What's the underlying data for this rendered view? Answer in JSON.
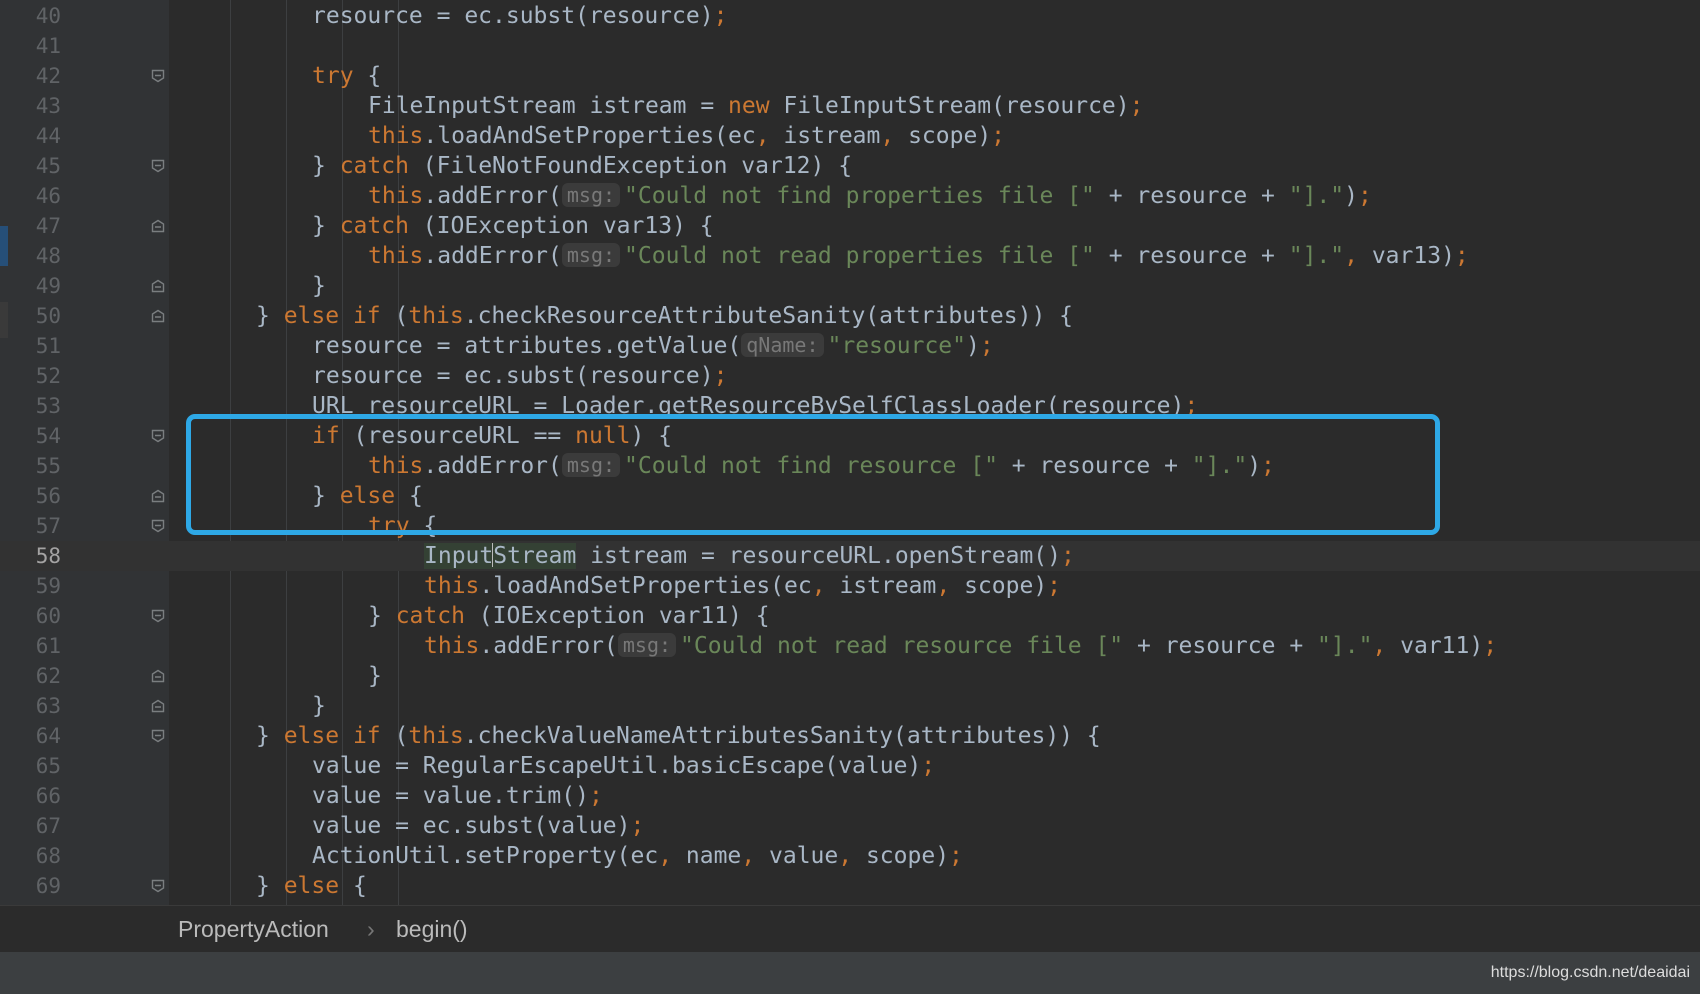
{
  "editor": {
    "lines": [
      {
        "n": "40",
        "indent": 5,
        "fold": "",
        "tokens": [
          [
            "t",
            "resource = ec.subst(resource)"
          ],
          [
            "k",
            ";"
          ]
        ]
      },
      {
        "n": "41",
        "indent": 0,
        "fold": "",
        "tokens": []
      },
      {
        "n": "42",
        "indent": 5,
        "fold": "open",
        "tokens": [
          [
            "k",
            "try"
          ],
          [
            "t",
            " {"
          ]
        ]
      },
      {
        "n": "43",
        "indent": 6,
        "fold": "",
        "tokens": [
          [
            "t",
            "FileInputStream istream = "
          ],
          [
            "k",
            "new"
          ],
          [
            "t",
            " FileInputStream(resource)"
          ],
          [
            "k",
            ";"
          ]
        ]
      },
      {
        "n": "44",
        "indent": 6,
        "fold": "",
        "tokens": [
          [
            "k",
            "this"
          ],
          [
            "t",
            ".loadAndSetProperties(ec"
          ],
          [
            "k",
            ","
          ],
          [
            "t",
            " istream"
          ],
          [
            "k",
            ","
          ],
          [
            "t",
            " scope)"
          ],
          [
            "k",
            ";"
          ]
        ]
      },
      {
        "n": "45",
        "indent": 5,
        "fold": "open",
        "tokens": [
          [
            "t",
            "} "
          ],
          [
            "k",
            "catch"
          ],
          [
            "t",
            " (FileNotFoundException var12) {"
          ]
        ]
      },
      {
        "n": "46",
        "indent": 6,
        "fold": "",
        "tokens": [
          [
            "k",
            "this"
          ],
          [
            "t",
            ".addError("
          ],
          [
            "h",
            "msg:"
          ],
          [
            "s",
            "\"Could not find properties file [\""
          ],
          [
            "t",
            " + resource + "
          ],
          [
            "s",
            "\"].\""
          ],
          [
            "t",
            ")"
          ],
          [
            "k",
            ";"
          ]
        ]
      },
      {
        "n": "47",
        "indent": 5,
        "fold": "close",
        "tokens": [
          [
            "t",
            "} "
          ],
          [
            "k",
            "catch"
          ],
          [
            "t",
            " (IOException var13) {"
          ]
        ]
      },
      {
        "n": "48",
        "indent": 6,
        "fold": "",
        "tokens": [
          [
            "k",
            "this"
          ],
          [
            "t",
            ".addError("
          ],
          [
            "h",
            "msg:"
          ],
          [
            "s",
            "\"Could not read properties file [\""
          ],
          [
            "t",
            " + resource + "
          ],
          [
            "s",
            "\"].\""
          ],
          [
            "k",
            ","
          ],
          [
            "t",
            " var13)"
          ],
          [
            "k",
            ";"
          ]
        ]
      },
      {
        "n": "49",
        "indent": 5,
        "fold": "close",
        "tokens": [
          [
            "t",
            "}"
          ]
        ]
      },
      {
        "n": "50",
        "indent": 4,
        "fold": "close",
        "tokens": [
          [
            "t",
            "} "
          ],
          [
            "k",
            "else if"
          ],
          [
            "t",
            " ("
          ],
          [
            "k",
            "this"
          ],
          [
            "t",
            ".checkResourceAttributeSanity(attributes)) {"
          ]
        ]
      },
      {
        "n": "51",
        "indent": 5,
        "fold": "",
        "tokens": [
          [
            "t",
            "resource = attributes.getValue("
          ],
          [
            "h",
            "qName:"
          ],
          [
            "s",
            "\"resource\""
          ],
          [
            "t",
            ")"
          ],
          [
            "k",
            ";"
          ]
        ]
      },
      {
        "n": "52",
        "indent": 5,
        "fold": "",
        "tokens": [
          [
            "t",
            "resource = ec.subst(resource)"
          ],
          [
            "k",
            ";"
          ]
        ]
      },
      {
        "n": "53",
        "indent": 5,
        "fold": "",
        "tokens": [
          [
            "t",
            "URL resourceURL = Loader.getResourceBySelfClassLoader(resource)"
          ],
          [
            "k",
            ";"
          ]
        ]
      },
      {
        "n": "54",
        "indent": 5,
        "fold": "open",
        "tokens": [
          [
            "k",
            "if"
          ],
          [
            "t",
            " (resourceURL == "
          ],
          [
            "k",
            "null"
          ],
          [
            "t",
            ") {"
          ]
        ]
      },
      {
        "n": "55",
        "indent": 6,
        "fold": "",
        "tokens": [
          [
            "k",
            "this"
          ],
          [
            "t",
            ".addError("
          ],
          [
            "h",
            "msg:"
          ],
          [
            "s",
            "\"Could not find resource [\""
          ],
          [
            "t",
            " + resource + "
          ],
          [
            "s",
            "\"].\""
          ],
          [
            "t",
            ")"
          ],
          [
            "k",
            ";"
          ]
        ]
      },
      {
        "n": "56",
        "indent": 5,
        "fold": "close",
        "tokens": [
          [
            "t",
            "} "
          ],
          [
            "k",
            "else"
          ],
          [
            "t",
            " {"
          ]
        ]
      },
      {
        "n": "57",
        "indent": 6,
        "fold": "open",
        "tokens": [
          [
            "k",
            "try"
          ],
          [
            "t",
            " {"
          ]
        ]
      },
      {
        "n": "58",
        "indent": 7,
        "fold": "",
        "current": true,
        "tokens": [
          [
            "m1",
            "Input"
          ],
          [
            "c",
            ""
          ],
          [
            "m2",
            "Stream"
          ],
          [
            "t",
            " istream = resourceURL.openStream()"
          ],
          [
            "k",
            ";"
          ]
        ]
      },
      {
        "n": "59",
        "indent": 7,
        "fold": "",
        "tokens": [
          [
            "k",
            "this"
          ],
          [
            "t",
            ".loadAndSetProperties(ec"
          ],
          [
            "k",
            ","
          ],
          [
            "t",
            " istream"
          ],
          [
            "k",
            ","
          ],
          [
            "t",
            " scope)"
          ],
          [
            "k",
            ";"
          ]
        ]
      },
      {
        "n": "60",
        "indent": 6,
        "fold": "open",
        "tokens": [
          [
            "t",
            "} "
          ],
          [
            "k",
            "catch"
          ],
          [
            "t",
            " (IOException var11) {"
          ]
        ]
      },
      {
        "n": "61",
        "indent": 7,
        "fold": "",
        "tokens": [
          [
            "k",
            "this"
          ],
          [
            "t",
            ".addError("
          ],
          [
            "h",
            "msg:"
          ],
          [
            "s",
            "\"Could not read resource file [\""
          ],
          [
            "t",
            " + resource + "
          ],
          [
            "s",
            "\"].\""
          ],
          [
            "k",
            ","
          ],
          [
            "t",
            " var11)"
          ],
          [
            "k",
            ";"
          ]
        ]
      },
      {
        "n": "62",
        "indent": 6,
        "fold": "close",
        "tokens": [
          [
            "t",
            "}"
          ]
        ]
      },
      {
        "n": "63",
        "indent": 5,
        "fold": "close",
        "tokens": [
          [
            "t",
            "}"
          ]
        ]
      },
      {
        "n": "64",
        "indent": 4,
        "fold": "open",
        "tokens": [
          [
            "t",
            "} "
          ],
          [
            "k",
            "else if"
          ],
          [
            "t",
            " ("
          ],
          [
            "k",
            "this"
          ],
          [
            "t",
            ".checkValueNameAttributesSanity(attributes)) {"
          ]
        ]
      },
      {
        "n": "65",
        "indent": 5,
        "fold": "",
        "tokens": [
          [
            "t",
            "value = RegularEscapeUtil.basicEscape(value)"
          ],
          [
            "k",
            ";"
          ]
        ]
      },
      {
        "n": "66",
        "indent": 5,
        "fold": "",
        "tokens": [
          [
            "t",
            "value = value.trim()"
          ],
          [
            "k",
            ";"
          ]
        ]
      },
      {
        "n": "67",
        "indent": 5,
        "fold": "",
        "tokens": [
          [
            "t",
            "value = ec.subst(value)"
          ],
          [
            "k",
            ";"
          ]
        ]
      },
      {
        "n": "68",
        "indent": 5,
        "fold": "",
        "tokens": [
          [
            "t",
            "ActionUtil.setProperty(ec"
          ],
          [
            "k",
            ","
          ],
          [
            "t",
            " name"
          ],
          [
            "k",
            ","
          ],
          [
            "t",
            " value"
          ],
          [
            "k",
            ","
          ],
          [
            "t",
            " scope)"
          ],
          [
            "k",
            ";"
          ]
        ]
      },
      {
        "n": "69",
        "indent": 4,
        "fold": "open",
        "tokens": [
          [
            "t",
            "} "
          ],
          [
            "k",
            "else"
          ],
          [
            "t",
            " {"
          ]
        ]
      }
    ]
  },
  "breadcrumb": {
    "items": [
      "PropertyAction",
      "begin()"
    ],
    "separator": "›"
  },
  "watermark": "https://blog.csdn.net/deaidai",
  "colors": {
    "keyword": "#cc7832",
    "string": "#6a8759",
    "text": "#a9b7c6",
    "highlight_box": "#2ea8e6",
    "background": "#2b2b2b"
  }
}
